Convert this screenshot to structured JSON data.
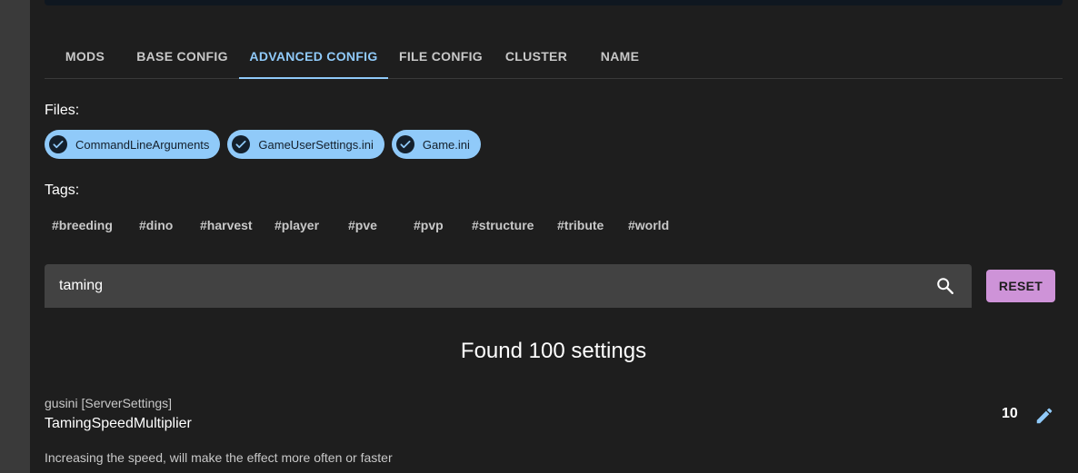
{
  "tabs": [
    {
      "label": "MODS"
    },
    {
      "label": "BASE CONFIG"
    },
    {
      "label": "ADVANCED CONFIG",
      "active": true
    },
    {
      "label": "FILE CONFIG"
    },
    {
      "label": "CLUSTER"
    },
    {
      "label": "NAME"
    }
  ],
  "files": {
    "label": "Files:",
    "chips": [
      "CommandLineArguments",
      "GameUserSettings.ini",
      "Game.ini"
    ]
  },
  "tags": {
    "label": "Tags:",
    "items": [
      "#breeding",
      "#dino",
      "#harvest",
      "#player",
      "#pve",
      "#pvp",
      "#structure",
      "#tribute",
      "#world"
    ]
  },
  "search": {
    "value": "taming",
    "icon": "search-icon"
  },
  "reset_label": "RESET",
  "results": {
    "found_text": "Found 100 settings"
  },
  "setting": {
    "meta": "gusini [ServerSettings]",
    "name": "TamingSpeedMultiplier",
    "value": "10",
    "description": "Increasing the speed, will make the effect more often or faster",
    "edit_icon": "pencil-icon"
  },
  "colors": {
    "accent": "#90caf9",
    "reset": "#ce93d8",
    "background": "#1e1e1e",
    "field": "#424242"
  }
}
